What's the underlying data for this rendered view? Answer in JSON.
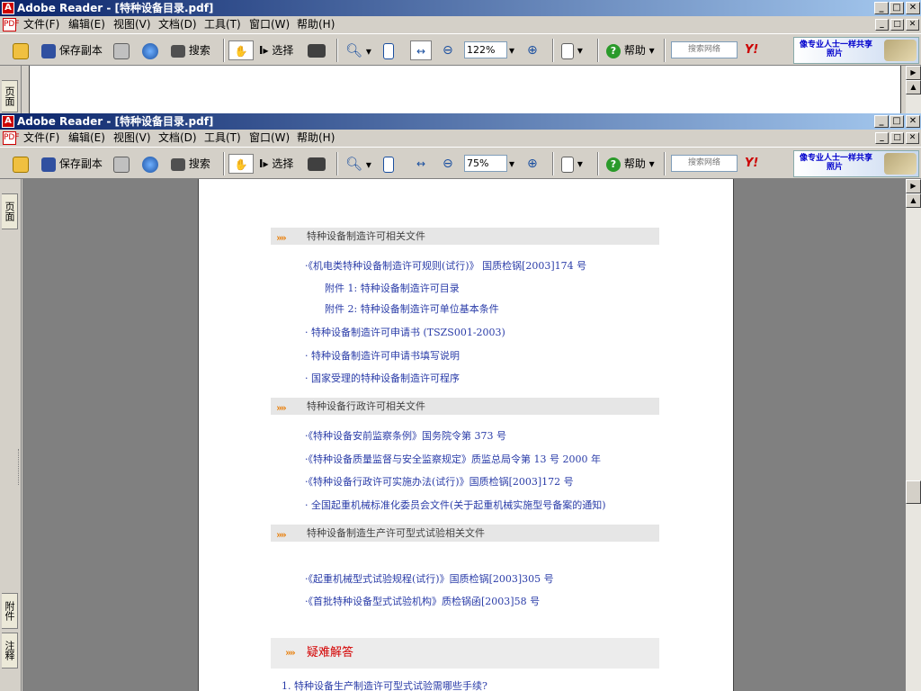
{
  "windows": [
    {
      "title": "Adobe Reader - [特种设备目录.pdf]",
      "zoom": "122%"
    },
    {
      "title": "Adobe Reader - [特种设备目录.pdf]",
      "zoom": "75%"
    }
  ],
  "menu": [
    "文件(F)",
    "编辑(E)",
    "视图(V)",
    "文档(D)",
    "工具(T)",
    "窗口(W)",
    "帮助(H)"
  ],
  "toolbar": {
    "save_copy": "保存副本",
    "search": "搜索",
    "select": "选择",
    "help": "帮助",
    "search_web_placeholder": "搜索网络",
    "yahoo": "Y!",
    "ad_line1": "像专业人士一样共享",
    "ad_line2": "照片"
  },
  "nav_tabs": {
    "pages": "页面",
    "attachments": "附件",
    "comments": "注释"
  },
  "document": {
    "sections": [
      {
        "heading": "特种设备制造许可相关文件",
        "items": [
          {
            "text": "·《机电类特种设备制造许可规则(试行)》 国质检锅[2003]174 号",
            "sub": false
          },
          {
            "text": "附件 1: 特种设备制造许可目录",
            "sub": true
          },
          {
            "text": "附件 2: 特种设备制造许可单位基本条件",
            "sub": true
          },
          {
            "text": "· 特种设备制造许可申请书 (TSZS001-2003)",
            "sub": false
          },
          {
            "text": "· 特种设备制造许可申请书填写说明",
            "sub": false
          },
          {
            "text": "· 国家受理的特种设备制造许可程序",
            "sub": false
          }
        ]
      },
      {
        "heading": "特种设备行政许可相关文件",
        "items": [
          {
            "text": "·《特种设备安前监察条例》国务院令第 373 号",
            "sub": false
          },
          {
            "text": "·《特种设备质量监督与安全监察规定》质监总局令第 13 号 2000 年",
            "sub": false
          },
          {
            "text": "·《特种设备行政许可实施办法(试行)》国质检锅[2003]172 号",
            "sub": false
          },
          {
            "text": "· 全国起重机械标准化委员会文件(关于起重机械实施型号备案的通知)",
            "sub": false
          }
        ]
      },
      {
        "heading": "特种设备制造生产许可型式试验相关文件",
        "items": [
          {
            "text": "·《起重机械型式试验规程(试行)》国质检锅[2003]305 号",
            "sub": false
          },
          {
            "text": "·《首批特种设备型式试验机构》质检锅函[2003]58 号",
            "sub": false
          }
        ]
      }
    ],
    "faq_heading": "疑难解答",
    "faq_first": "1. 特种设备生产制造许可型式试验需哪些手续?"
  }
}
